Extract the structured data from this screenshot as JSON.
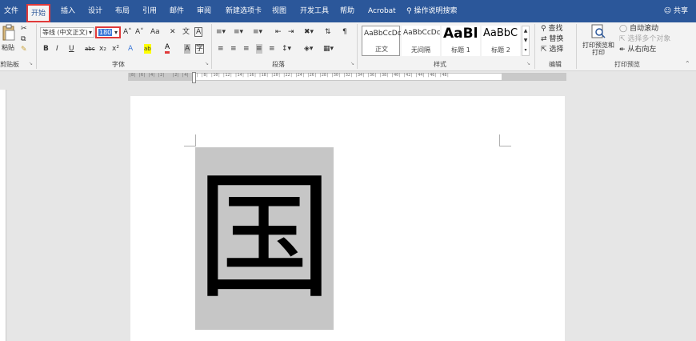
{
  "menu": {
    "tabs": [
      "文件",
      "开始",
      "插入",
      "设计",
      "布局",
      "引用",
      "邮件",
      "审阅",
      "新建选项卡",
      "视图",
      "开发工具",
      "帮助",
      "Acrobat"
    ],
    "search_label": "操作说明搜索",
    "share_label": "共享"
  },
  "ribbon": {
    "clipboard": {
      "paste_label": "粘贴",
      "group_label": "剪贴板"
    },
    "font": {
      "font_name": "等线 (中文正文)",
      "font_size": "180",
      "grow_label": "A˄",
      "shrink_label": "A˅",
      "case_label": "Aa",
      "phonetic_label": "文",
      "border_label": "A",
      "bold": "B",
      "italic": "I",
      "underline": "U",
      "strike": "abc",
      "subscript": "x₂",
      "superscript": "x²",
      "effects_label": "A",
      "highlight_label": "ab",
      "color_label": "A",
      "shading_label": "A",
      "enclose_label": "字",
      "group_label": "字体"
    },
    "paragraph": {
      "group_label": "段落"
    },
    "styles": {
      "items": [
        {
          "preview": "AaBbCcDc",
          "name": "正文"
        },
        {
          "preview": "AaBbCcDc",
          "name": "无间隔"
        },
        {
          "preview": "AaBl",
          "name": "标题 1"
        },
        {
          "preview": "AaBbC",
          "name": "标题 2"
        }
      ],
      "group_label": "样式"
    },
    "editing": {
      "find_label": "查找",
      "replace_label": "替换",
      "select_label": "选择",
      "group_label": "编辑"
    },
    "print_preview": {
      "preview_print_label": "打印预览和打印",
      "auto_scroll_label": "自动滚动",
      "select_multiple_label": "选择多个对象",
      "rtl_label": "从右向左",
      "group_label": "打印预览"
    }
  },
  "ruler": {
    "numbers": "|8| |6| |4| |2|   |2| |4| |6| |8| |10| |12| |14| |16| |18| |20| |22| |24| |26| |28| |30| |32| |34| |36| |38| |40| |42| |44| |46| |48|"
  },
  "document": {
    "character": "国"
  }
}
